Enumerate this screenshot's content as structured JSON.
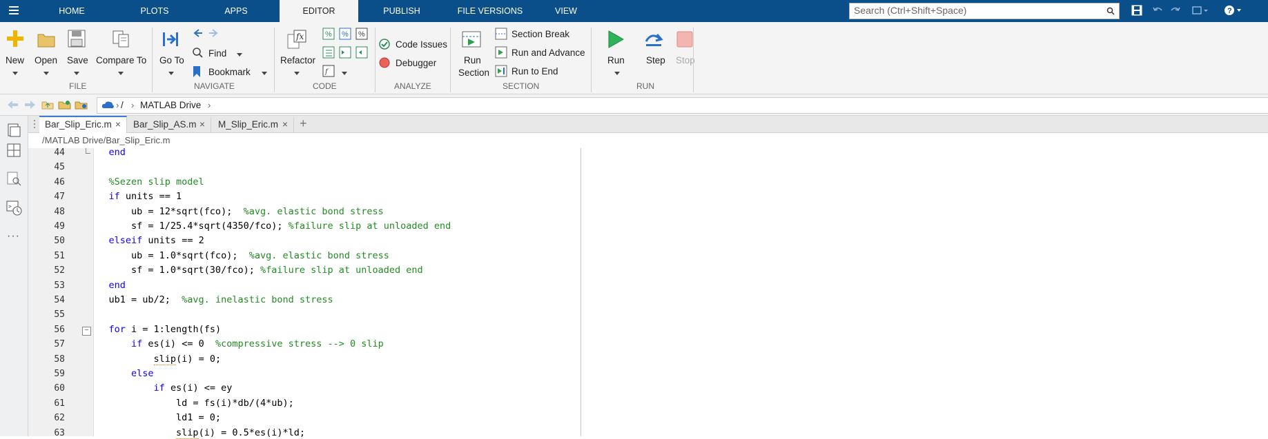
{
  "topbar": {
    "tabs": [
      {
        "label": "HOME"
      },
      {
        "label": "PLOTS"
      },
      {
        "label": "APPS"
      },
      {
        "label": "EDITOR"
      },
      {
        "label": "PUBLISH"
      },
      {
        "label": "FILE VERSIONS"
      },
      {
        "label": "VIEW"
      }
    ],
    "search_placeholder": "Search (Ctrl+Shift+Space)"
  },
  "ribbon": {
    "file": {
      "new": "New",
      "open": "Open",
      "save": "Save",
      "compare": "Compare To",
      "group": "FILE"
    },
    "navigate": {
      "goto": "Go To",
      "find": "Find",
      "bookmark": "Bookmark",
      "group": "NAVIGATE"
    },
    "code": {
      "refactor": "Refactor",
      "group": "CODE"
    },
    "analyze": {
      "code_issues": "Code Issues",
      "debugger": "Debugger",
      "group": "ANALYZE"
    },
    "section": {
      "run_section_1": "Run",
      "run_section_2": "Section",
      "section_break": "Section Break",
      "run_advance": "Run and Advance",
      "run_to_end": "Run to End",
      "group": "SECTION"
    },
    "run": {
      "run": "Run",
      "step": "Step",
      "stop": "Stop",
      "group": "RUN"
    }
  },
  "address": {
    "root": "/",
    "folder": "MATLAB Drive"
  },
  "doc_tabs": [
    {
      "label": "Bar_Slip_Eric.m"
    },
    {
      "label": "Bar_Slip_AS.m"
    },
    {
      "label": "M_Slip_Eric.m"
    }
  ],
  "path": "/MATLAB Drive/Bar_Slip_Eric.m",
  "colors": {
    "titlebar": "#0b4f8a",
    "keyword": "#0e00ff",
    "comment": "#228b22"
  },
  "lines": [
    {
      "n": "44",
      "parts": [
        {
          "t": "    "
        },
        {
          "t": "end",
          "c": "kw"
        }
      ]
    },
    {
      "n": "45",
      "parts": []
    },
    {
      "n": "46",
      "parts": [
        {
          "t": "    "
        },
        {
          "t": "%Sezen slip model",
          "c": "cm"
        }
      ]
    },
    {
      "n": "47",
      "parts": [
        {
          "t": "    "
        },
        {
          "t": "if",
          "c": "kw"
        },
        {
          "t": " units == 1"
        }
      ]
    },
    {
      "n": "48",
      "parts": [
        {
          "t": "        ub = 12*sqrt(fco);  "
        },
        {
          "t": "%avg. elastic bond stress",
          "c": "cm"
        }
      ]
    },
    {
      "n": "49",
      "parts": [
        {
          "t": "        sf = 1/25.4*sqrt(4350/fco); "
        },
        {
          "t": "%failure slip at unloaded end",
          "c": "cm"
        }
      ]
    },
    {
      "n": "50",
      "parts": [
        {
          "t": "    "
        },
        {
          "t": "elseif",
          "c": "kw"
        },
        {
          "t": " units == 2"
        }
      ]
    },
    {
      "n": "51",
      "parts": [
        {
          "t": "        ub = 1.0*sqrt(fco);  "
        },
        {
          "t": "%avg. elastic bond stress",
          "c": "cm"
        }
      ]
    },
    {
      "n": "52",
      "parts": [
        {
          "t": "        sf = 1.0*sqrt(30/fco); "
        },
        {
          "t": "%failure slip at unloaded end",
          "c": "cm"
        }
      ]
    },
    {
      "n": "53",
      "parts": [
        {
          "t": "    "
        },
        {
          "t": "end",
          "c": "kw"
        }
      ]
    },
    {
      "n": "54",
      "parts": [
        {
          "t": "    ub1 = ub/2;  "
        },
        {
          "t": "%avg. inelastic bond stress",
          "c": "cm"
        }
      ]
    },
    {
      "n": "55",
      "parts": []
    },
    {
      "n": "56",
      "parts": [
        {
          "t": "    "
        },
        {
          "t": "for",
          "c": "kw"
        },
        {
          "t": " i = 1:length(fs)"
        }
      ]
    },
    {
      "n": "57",
      "parts": [
        {
          "t": "        "
        },
        {
          "t": "if",
          "c": "kw"
        },
        {
          "t": " es(i) <= 0  "
        },
        {
          "t": "%compressive stress --> 0 slip",
          "c": "cm"
        }
      ]
    },
    {
      "n": "58",
      "parts": [
        {
          "t": "            "
        },
        {
          "t": "slip",
          "c": "sq"
        },
        {
          "t": "(i) = 0;"
        }
      ]
    },
    {
      "n": "59",
      "parts": [
        {
          "t": "        "
        },
        {
          "t": "else",
          "c": "kw"
        }
      ]
    },
    {
      "n": "60",
      "parts": [
        {
          "t": "            "
        },
        {
          "t": "if",
          "c": "kw"
        },
        {
          "t": " es(i) <= ey"
        }
      ]
    },
    {
      "n": "61",
      "parts": [
        {
          "t": "                ld = fs(i)*db/(4*ub);"
        }
      ]
    },
    {
      "n": "62",
      "parts": [
        {
          "t": "                ld1 = 0;"
        }
      ]
    },
    {
      "n": "63",
      "parts": [
        {
          "t": "                "
        },
        {
          "t": "slip",
          "c": "sq"
        },
        {
          "t": "(i) = 0.5*es(i)*ld;"
        }
      ]
    }
  ]
}
